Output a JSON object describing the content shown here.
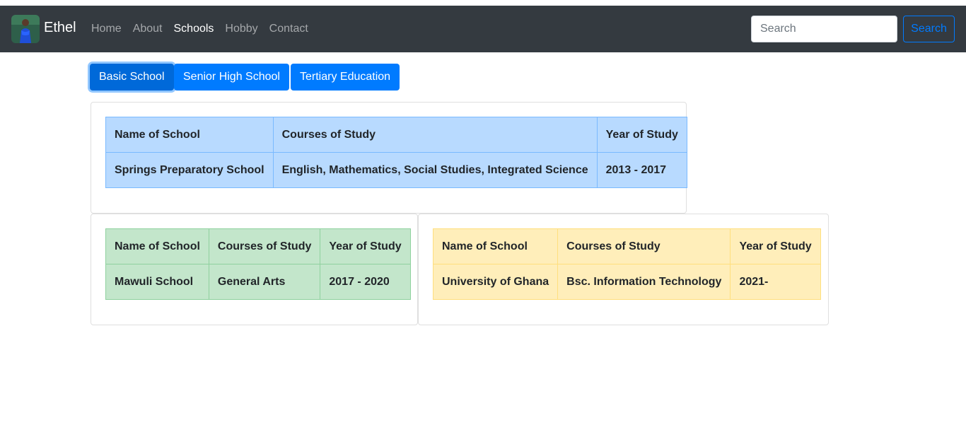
{
  "navbar": {
    "brand": "Ethel",
    "links": [
      "Home",
      "About",
      "Schools",
      "Hobby",
      "Contact"
    ],
    "active_link": "Schools",
    "search_placeholder": "Search",
    "search_button": "Search"
  },
  "tabs": [
    "Basic School",
    "Senior High School",
    "Tertiary Education"
  ],
  "tables": [
    {
      "headers": [
        "Name of School",
        "Courses of Study",
        "Year of Study"
      ],
      "row": [
        "Springs Preparatory School",
        "English, Mathematics, Social Studies, Integrated Science",
        "2013 - 2017"
      ]
    },
    {
      "headers": [
        "Name of School",
        "Courses of Study",
        "Year of Study"
      ],
      "row": [
        "Mawuli School",
        "General Arts",
        "2017 - 2020"
      ]
    },
    {
      "headers": [
        "Name of School",
        "Courses of Study",
        "Year of Study"
      ],
      "row": [
        "University of Ghana",
        "Bsc. Information Technology",
        "2021-"
      ]
    }
  ],
  "colors": {
    "navbar_bg": "#343a40",
    "primary": "#007bff",
    "table_blue": "#b8daff",
    "table_green": "#c3e6cb",
    "table_yellow": "#ffeeba"
  }
}
